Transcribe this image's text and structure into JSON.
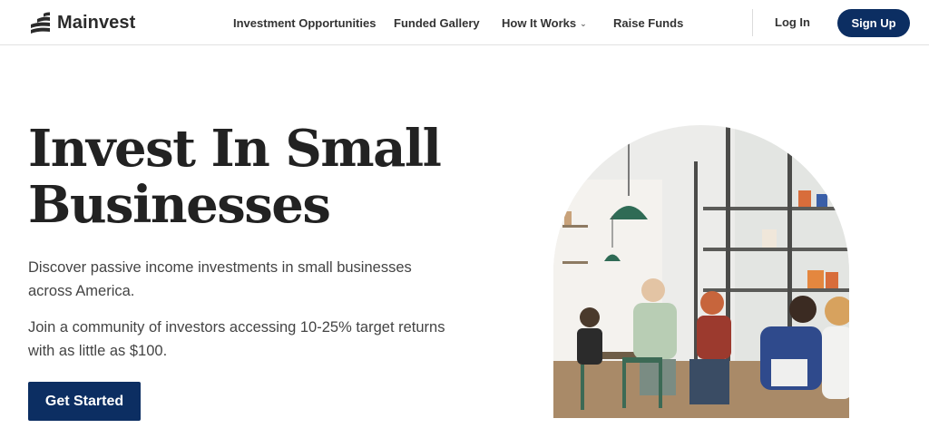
{
  "brand": {
    "name": "Mainvest",
    "logo_icon": "mainvest-logo-icon"
  },
  "nav": {
    "items": [
      {
        "label": "Investment Opportunities"
      },
      {
        "label": "Funded Gallery"
      },
      {
        "label": "How It Works",
        "has_dropdown": true
      },
      {
        "label": "Raise Funds"
      }
    ],
    "login_label": "Log In",
    "signup_label": "Sign Up"
  },
  "hero": {
    "title_line1": "Invest In Small",
    "title_line2": "Businesses",
    "paragraph1": "Discover passive income investments in small businesses across America.",
    "paragraph2": "Join a community of investors accessing 10-25% target returns with as little as $100.",
    "cta_label": "Get Started",
    "image": "cafe-people-photo"
  },
  "colors": {
    "primary": "#0c2e62",
    "text": "#222222",
    "body_text": "#444444"
  }
}
